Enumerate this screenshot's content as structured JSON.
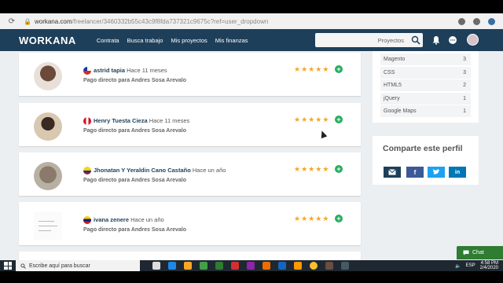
{
  "browser": {
    "url_main": "workana.com",
    "url_rest": "/freelancer/3460332b55c43c9f8fda737321c9675c?ref=user_dropdown"
  },
  "header": {
    "logo": "WORKANA",
    "nav": [
      "Contrata",
      "Busca trabajo",
      "Mis proyectos",
      "Mis finanzas"
    ],
    "search_placeholder": "Proyectos"
  },
  "reviews": [
    {
      "name": "astrid tapia",
      "time": "Hace 11 meses",
      "description": "Pago directo para Andres Sosa Arevalo",
      "rating": 5,
      "flag": "chile"
    },
    {
      "name": "Henry Tuesta Cieza",
      "time": "Hace 11 meses",
      "description": "Pago directo para Andres Sosa Arevalo",
      "rating": 5,
      "flag": "peru"
    },
    {
      "name": "Jhonatan Y Yeraldin Cano Castaño",
      "time": "Hace un año",
      "description": "Pago directo para Andres Sosa Arevalo",
      "rating": 5,
      "flag": "colombia"
    },
    {
      "name": "ivana zenere",
      "time": "Hace un año",
      "description": "Pago directo para Andres Sosa Arevalo",
      "rating": 5,
      "flag": "venezuela"
    }
  ],
  "skills": [
    {
      "name": "Magento",
      "count": "3"
    },
    {
      "name": "CSS",
      "count": "3"
    },
    {
      "name": "HTML5",
      "count": "2"
    },
    {
      "name": "jQuery",
      "count": "1"
    },
    {
      "name": "Google Maps",
      "count": "1"
    }
  ],
  "share": {
    "title": "Comparte este perfil",
    "buttons": [
      "email",
      "facebook",
      "twitter",
      "linkedin"
    ],
    "colors": {
      "email": "#1e3f5a",
      "facebook": "#3b5998",
      "twitter": "#1da1f2",
      "linkedin": "#0077b5"
    }
  },
  "chat": {
    "label": "Chat"
  },
  "taskbar": {
    "search_placeholder": "Escribe aquí para buscar",
    "language": "ESP",
    "time": "4:58 PM",
    "date": "2/4/2020"
  },
  "colors": {
    "header": "#1e3f5a",
    "star": "#f5a623",
    "accent_green": "#27ae60"
  }
}
